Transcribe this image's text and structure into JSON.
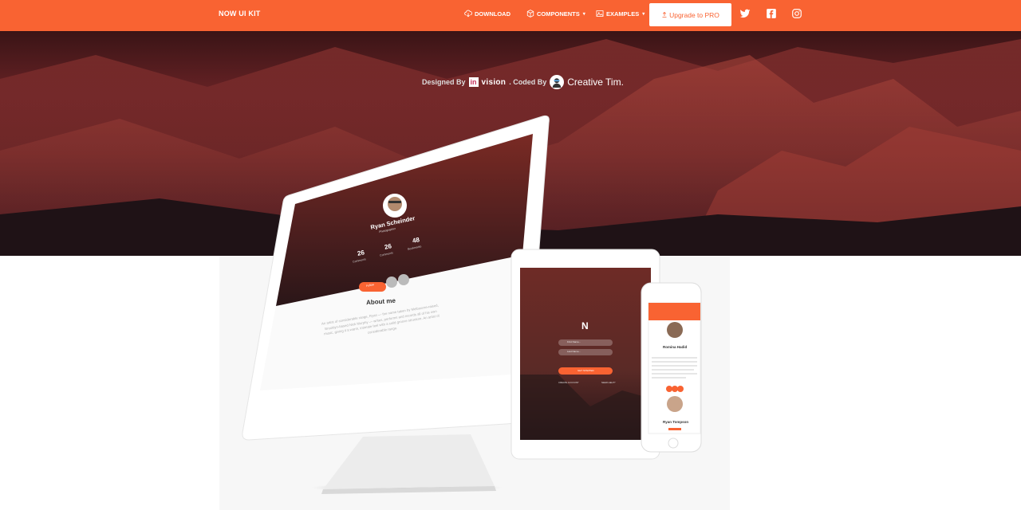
{
  "navbar": {
    "brand": "NOW UI KIT",
    "download": "DOWNLOAD",
    "components": "COMPONENTS",
    "examples": "EXAMPLES",
    "upgrade": "Upgrade to PRO",
    "social_icons": [
      "twitter-icon",
      "facebook-icon",
      "instagram-icon"
    ]
  },
  "credits": {
    "designed_by": "Designed By",
    "invision_mark": "in",
    "invision_word": "vision",
    "coded_by": ". Coded By",
    "creative_tim": "Creative Tim."
  },
  "monitor_screen": {
    "profile_name": "Ryan Scheinder",
    "subtitle": "Photographer",
    "stats": [
      {
        "value": "26",
        "label": "Comments"
      },
      {
        "value": "26",
        "label": "Comments"
      },
      {
        "value": "48",
        "label": "Bookmarks"
      }
    ],
    "follow": "Follow",
    "about_title": "About me",
    "about_text": "An artist of considerable range, Ryan — the name taken by Melbourne-raised, Brooklyn-based Nick Murphy — writes, performs and records all of his own music, giving it a warm, intimate feel with a solid groove structure. An artist of considerable range."
  },
  "tablet_screen": {
    "logo": "N",
    "first_name": "First Name...",
    "last_name": "Last Name...",
    "button": "GET STARTED",
    "create": "CREATE ACCOUNT",
    "help": "NEED HELP?"
  },
  "phone_screen": {
    "person1": "Romina Hadid",
    "person2": "Ryan Tompson"
  },
  "colors": {
    "accent": "#f96332",
    "hero_dark": "#3a1416",
    "white": "#ffffff"
  }
}
